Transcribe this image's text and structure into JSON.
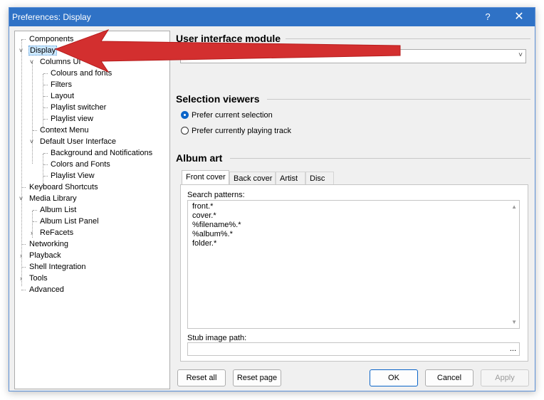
{
  "window": {
    "title": "Preferences: Display",
    "help_glyph": "?",
    "close_glyph": "✕"
  },
  "tree": {
    "items": [
      {
        "label": "Components",
        "expander": ""
      },
      {
        "label": "Display",
        "expander": "˅"
      },
      {
        "label": "Columns UI",
        "expander": "˅"
      },
      {
        "label": "Colours and fonts",
        "expander": ""
      },
      {
        "label": "Filters",
        "expander": ""
      },
      {
        "label": "Layout",
        "expander": ""
      },
      {
        "label": "Playlist switcher",
        "expander": ""
      },
      {
        "label": "Playlist view",
        "expander": ""
      },
      {
        "label": "Context Menu",
        "expander": ""
      },
      {
        "label": "Default User Interface",
        "expander": "˅"
      },
      {
        "label": "Background and Notifications",
        "expander": ""
      },
      {
        "label": "Colors and Fonts",
        "expander": ""
      },
      {
        "label": "Playlist View",
        "expander": ""
      },
      {
        "label": "Keyboard Shortcuts",
        "expander": ""
      },
      {
        "label": "Media Library",
        "expander": "˅"
      },
      {
        "label": "Album List",
        "expander": ""
      },
      {
        "label": "Album List Panel",
        "expander": ""
      },
      {
        "label": "ReFacets",
        "expander": "›"
      },
      {
        "label": "Networking",
        "expander": ""
      },
      {
        "label": "Playback",
        "expander": "›"
      },
      {
        "label": "Shell Integration",
        "expander": ""
      },
      {
        "label": "Tools",
        "expander": "›"
      },
      {
        "label": "Advanced",
        "expander": ""
      }
    ]
  },
  "ui_module": {
    "heading": "User interface module",
    "selected": "Columns UI",
    "chevron": "˅"
  },
  "selection_viewers": {
    "heading": "Selection viewers",
    "options": [
      "Prefer current selection",
      "Prefer currently playing track"
    ]
  },
  "album_art": {
    "heading": "Album art",
    "tabs": [
      "Front cover",
      "Back cover",
      "Artist",
      "Disc"
    ],
    "search_label": "Search patterns:",
    "patterns": [
      "front.*",
      "cover.*",
      "%filename%.*",
      "%album%.*",
      "folder.*"
    ],
    "stub_label": "Stub image path:",
    "stub_more": "...",
    "scroll_up": "▲",
    "scroll_down": "▼"
  },
  "buttons": {
    "reset_all": "Reset all",
    "reset_page": "Reset page",
    "ok": "OK",
    "cancel": "Cancel",
    "apply": "Apply"
  },
  "colors": {
    "titlebar": "#2f72c6",
    "accent": "#0a64c8",
    "arrow": "#d32f2f"
  }
}
